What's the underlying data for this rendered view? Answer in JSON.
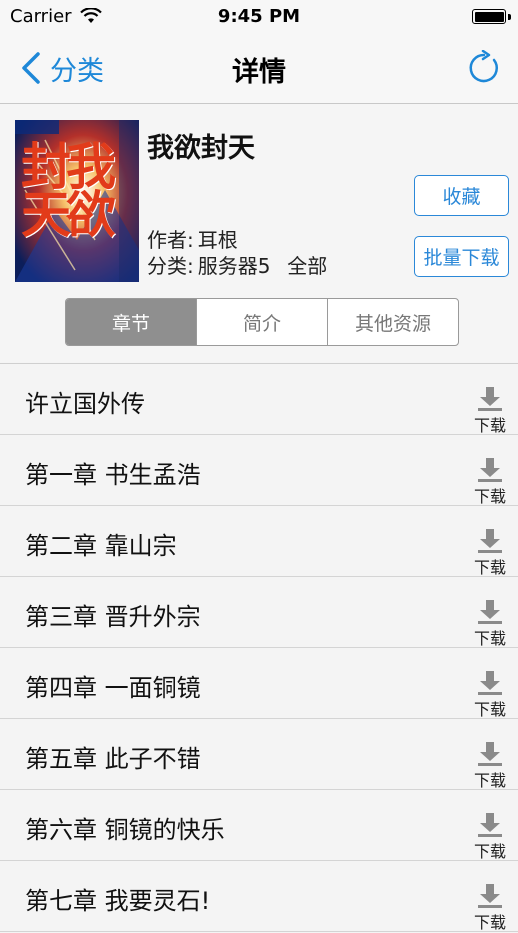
{
  "status_bar": {
    "carrier": "Carrier",
    "time": "9:45 PM"
  },
  "nav": {
    "back_label": "分类",
    "title": "详情"
  },
  "book": {
    "title": "我欲封天",
    "cover_title": "我欲封天",
    "author_label": "作者:",
    "author": "耳根",
    "category_label": "分类:",
    "category": "服务器5",
    "status": "全部"
  },
  "buttons": {
    "favorite": "收藏",
    "batch_download": "批量下载"
  },
  "tabs": [
    {
      "label": "章节",
      "active": true
    },
    {
      "label": "简介",
      "active": false
    },
    {
      "label": "其他资源",
      "active": false
    }
  ],
  "chapters": [
    {
      "title": "许立国外传",
      "download_label": "下载"
    },
    {
      "title": "第一章 书生孟浩",
      "download_label": "下载"
    },
    {
      "title": "第二章 靠山宗",
      "download_label": "下载"
    },
    {
      "title": "第三章 晋升外宗",
      "download_label": "下载"
    },
    {
      "title": "第四章 一面铜镜",
      "download_label": "下载"
    },
    {
      "title": "第五章 此子不错",
      "download_label": "下载"
    },
    {
      "title": "第六章 铜镜的快乐",
      "download_label": "下载"
    },
    {
      "title": "第七章 我要灵石!",
      "download_label": "下载"
    }
  ],
  "colors": {
    "accent": "#1e88d8",
    "segment_active": "#8f8f8f"
  }
}
